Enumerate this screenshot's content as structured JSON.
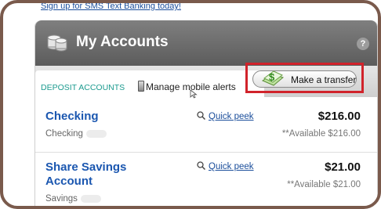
{
  "top_link": {
    "text": "Sign up for SMS Text Banking today!"
  },
  "widget": {
    "title": "My Accounts",
    "help": "?"
  },
  "tabs": {
    "deposit_label": "DEPOSIT ACCOUNTS",
    "mobile_alerts_label": "Manage mobile alerts",
    "transfer_label": "Make a transfer"
  },
  "accounts": [
    {
      "name": "Checking",
      "type": "Checking",
      "peek_label": "Quick peek",
      "balance": "$216.00",
      "available": "**Available $216.00"
    },
    {
      "name": "Share Savings Account",
      "type": "Savings",
      "peek_label": "Quick peek",
      "balance": "$21.00",
      "available": "**Available $21.00"
    }
  ],
  "colors": {
    "frame_border": "#7a5a4c",
    "highlight": "#d1232b",
    "link": "#1b4e9b",
    "account_name": "#1b57b0",
    "tab_label": "#1c9b8f"
  }
}
